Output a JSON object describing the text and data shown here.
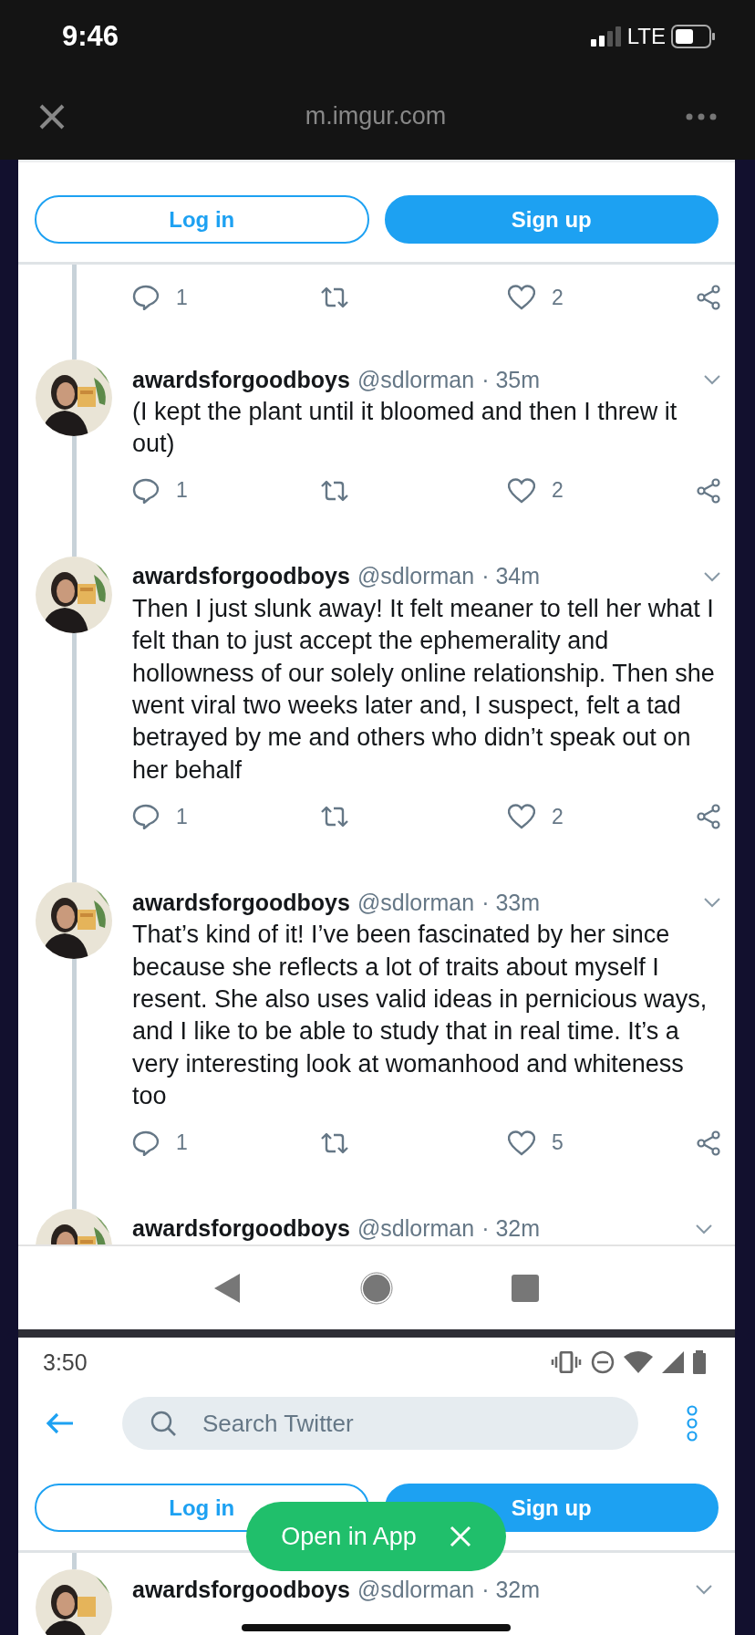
{
  "status_bar": {
    "time": "9:46",
    "network": "LTE"
  },
  "browser_bar": {
    "url": "m.imgur.com"
  },
  "top_shot": {
    "login": "Log in",
    "signup": "Sign up",
    "tweets": [
      {
        "replies": "1",
        "likes": "2"
      },
      {
        "name": "awardsforgoodboys",
        "handle": "@sdlorman",
        "time": "· 35m",
        "text": "(I kept the plant until it bloomed and then I threw it out)",
        "replies": "1",
        "likes": "2"
      },
      {
        "name": "awardsforgoodboys",
        "handle": "@sdlorman",
        "time": "· 34m",
        "text": "Then I just slunk away! It felt meaner to tell her what I felt than to just accept the ephemerality and hollowness of our solely online relationship. Then she went viral two weeks later and, I suspect, felt a tad betrayed by me and others who didn’t speak out on her behalf",
        "replies": "1",
        "likes": "2"
      },
      {
        "name": "awardsforgoodboys",
        "handle": "@sdlorman",
        "time": "· 33m",
        "text": "That’s kind of it! I’ve been fascinated by her since because she reflects a lot of traits about myself I resent. She also uses valid ideas in pernicious ways, and I like to be able to study that in real time. It’s a very interesting look at womanhood and whiteness too",
        "replies": "1",
        "likes": "5"
      },
      {
        "name": "awardsforgoodboys",
        "handle": "@sdlorman",
        "time": "· 32m"
      }
    ]
  },
  "bottom_shot": {
    "time": "3:50",
    "search_placeholder": "Search Twitter",
    "login": "Log in",
    "signup": "Sign up",
    "tweet": {
      "name": "awardsforgoodboys",
      "handle": "@sdlorman",
      "time": "· 32m"
    }
  },
  "open_in_app": {
    "label": "Open in App"
  }
}
